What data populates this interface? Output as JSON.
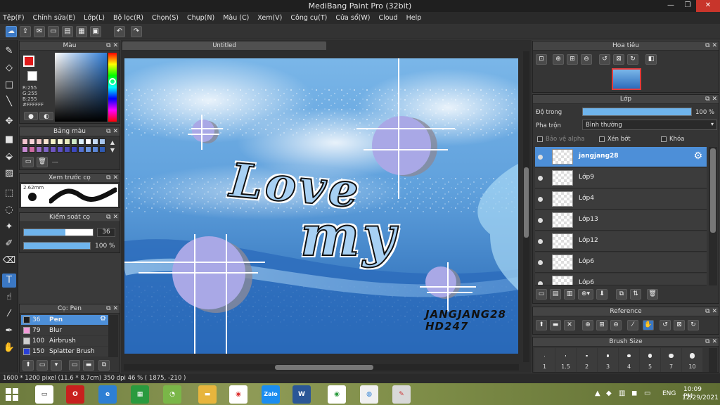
{
  "window": {
    "title": "MediBang Paint Pro (32bit)",
    "min": "—",
    "max": "❐",
    "close": "✕"
  },
  "menu": [
    "Tệp(F)",
    "Chỉnh sửa(E)",
    "Lớp(L)",
    "Bộ lọc(R)",
    "Chọn(S)",
    "Chụp(N)",
    "Màu (C)",
    "Xem(V)",
    "Công cụ(T)",
    "Cửa sổ(W)",
    "Cloud",
    "Help"
  ],
  "color_panel": {
    "title": "Màu",
    "r": "R:255",
    "g": "G:255",
    "b": "B:255",
    "hex": "#FFFFFF",
    "fg_color": "#e01a1a",
    "bg_color": "#ffffff"
  },
  "palette_panel": {
    "title": "Bảng màu",
    "dash": "---",
    "swatches": [
      "#f3c4d0",
      "#f7d3d8",
      "#f2c8c8",
      "#f8e3cf",
      "#f6f1c9",
      "#fbf8dc",
      "#e9ecbd",
      "#cfe9c8",
      "#dbeefa",
      "#ffffff",
      "#c5d9f1",
      "#a6c4ec",
      "#c78ad4",
      "#d06aa1",
      "#9b6fc6",
      "#7e64c6",
      "#6f55c1",
      "#5d4fc2",
      "#4a4ab8",
      "#3c48c0",
      "#5472d0",
      "#6994e0",
      "#5b86d5",
      "#2e5ab3"
    ]
  },
  "brush_preview": {
    "title": "Xem trước cọ",
    "size": "2.62mm"
  },
  "brush_control": {
    "title": "Kiểm soát cọ",
    "size_value": "36",
    "size_fraction": 0.6,
    "opacity_value": "100 %",
    "opacity_fraction": 1.0
  },
  "brush_list": {
    "title": "Cọ: Pen",
    "items": [
      {
        "size": "36",
        "name": "Pen",
        "color": "#1c1c1c",
        "selected": true
      },
      {
        "size": "79",
        "name": "Blur",
        "color": "#f29bd8",
        "selected": false
      },
      {
        "size": "100",
        "name": "Airbrush",
        "color": "#cfcfcf",
        "selected": false
      },
      {
        "size": "150",
        "name": "Splatter Brush",
        "color": "#2940d8",
        "selected": false
      }
    ]
  },
  "document": {
    "tab": "Untitled"
  },
  "artwork": {
    "title_line1": "Love",
    "title_line2": "my",
    "signature_line1": "JANGJANG28",
    "signature_line2": "HD247"
  },
  "navigator": {
    "title": "Hoa tiêu"
  },
  "layer_panel": {
    "title": "Lớp",
    "opacity_label": "Độ trong",
    "opacity_value": "100 %",
    "opacity_fraction": 1.0,
    "blend_label": "Pha trộn",
    "blend_value": "Bình thường",
    "protect_alpha": "Bảo vệ alpha",
    "clipping": "Xén bớt",
    "lock": "Khóa",
    "layers": [
      {
        "name": "jangjang28",
        "selected": true
      },
      {
        "name": "Lớp9",
        "selected": false
      },
      {
        "name": "Lớp4",
        "selected": false
      },
      {
        "name": "Lớp13",
        "selected": false
      },
      {
        "name": "Lớp12",
        "selected": false
      },
      {
        "name": "Lớp6",
        "selected": false
      },
      {
        "name": "Lớp6",
        "selected": false
      }
    ]
  },
  "reference_panel": {
    "title": "Reference"
  },
  "brush_size_panel": {
    "title": "Brush Size",
    "sizes": [
      "1",
      "1.5",
      "2",
      "3",
      "4",
      "5",
      "7",
      "10"
    ]
  },
  "statusbar": {
    "info": "1600 * 1200 pixel   (11.6 * 8.7cm)   350 dpi   46 %   ( 1875, -210 )"
  },
  "taskbar": {
    "lang": "ENG",
    "time": "10:09 PM",
    "date": "12/29/2021"
  }
}
